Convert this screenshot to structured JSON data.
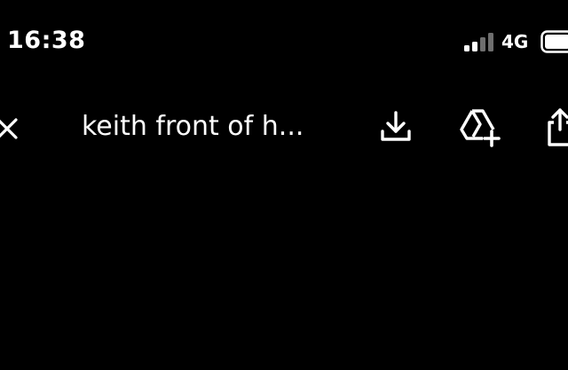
{
  "status_bar": {
    "time": "16:38",
    "network": "4G",
    "signal_icon": "cellular-signal-icon",
    "battery_icon": "battery-icon"
  },
  "toolbar": {
    "title": "keith front of h...",
    "close_icon": "close-icon",
    "download_icon": "download-icon",
    "add_to_drive_icon": "add-to-drive-icon",
    "share_icon": "share-icon"
  },
  "colors": {
    "background": "#000000",
    "foreground": "#ffffff",
    "inactive_signal": "#6e6e6e"
  }
}
